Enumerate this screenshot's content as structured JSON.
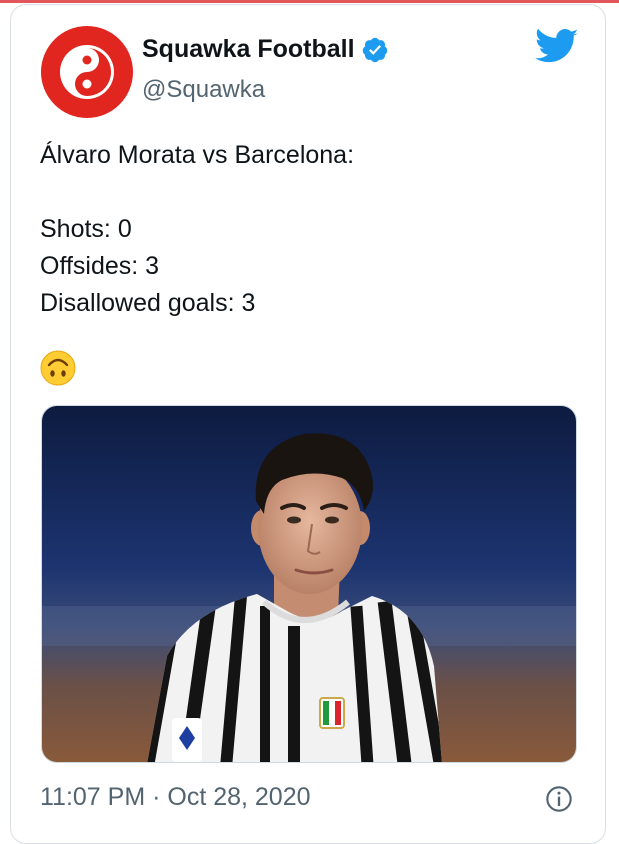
{
  "tweet": {
    "author_name": "Squawka Football",
    "handle": "@Squawka",
    "text_lines": [
      "Álvaro Morata vs Barcelona:",
      "",
      "Shots: 0",
      "Offsides: 3",
      "Disallowed goals: 3"
    ],
    "emoji": "🙃",
    "timestamp": "11:07 PM · Oct 28, 2020"
  },
  "icons": {
    "avatar": "squawka-logo-icon",
    "verified": "verified-badge-icon",
    "brand": "twitter-bird-icon",
    "info": "info-icon"
  },
  "colors": {
    "accent_red": "#e0261f",
    "twitter_blue": "#1d9bf0",
    "text": "#0f1419",
    "muted": "#536471"
  }
}
